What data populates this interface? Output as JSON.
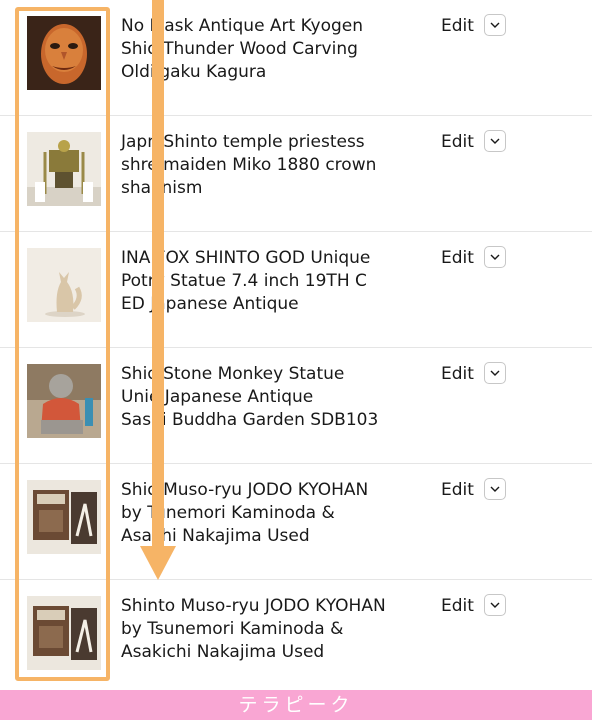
{
  "listings": [
    {
      "title_lines": [
        "No​ Mask Antique Art Kyogen",
        "Shi​o Thunder Wood Carving",
        "Old​iigaku Kagura"
      ],
      "edit_label": "Edit",
      "thumbnail": "noh-mask-photo"
    },
    {
      "title_lines": [
        "Jap​n Shinto temple priestess",
        "shr​e maiden Miko 1880 crown",
        "sha​anism"
      ],
      "edit_label": "Edit",
      "thumbnail": "miko-crown-photo"
    },
    {
      "title_lines": [
        "INA​  FOX SHINTO GOD Unique",
        "Pot​ry Statue 7.4 inch 19TH C",
        "ED​ Japanese Antique"
      ],
      "edit_label": "Edit",
      "thumbnail": "fox-statue-photo"
    },
    {
      "title_lines": [
        "Shi​o Stone Monkey Statue",
        "Uni​e Japanese Antique",
        "Sa​shi Buddha Garden SDB103"
      ],
      "edit_label": "Edit",
      "thumbnail": "monkey-statue-photo"
    },
    {
      "title_lines": [
        "Shi​o Muso-ryu JODO KYOHAN",
        "by T​unemori Kaminoda &",
        "Asa​chi Nakajima Used"
      ],
      "edit_label": "Edit",
      "thumbnail": "jodo-book-photo"
    },
    {
      "title_lines": [
        "Shinto Muso-ryu JODO KYOHAN",
        "by Tsunemori Kaminoda &",
        "Asakichi Nakajima Used"
      ],
      "edit_label": "Edit",
      "thumbnail": "jodo-book-photo"
    }
  ],
  "watermark": "テラピーク",
  "colors": {
    "highlight": "#f6b466",
    "banner": "#f9a6d3"
  },
  "icons": {
    "edit_menu": "chevron-down-icon"
  }
}
